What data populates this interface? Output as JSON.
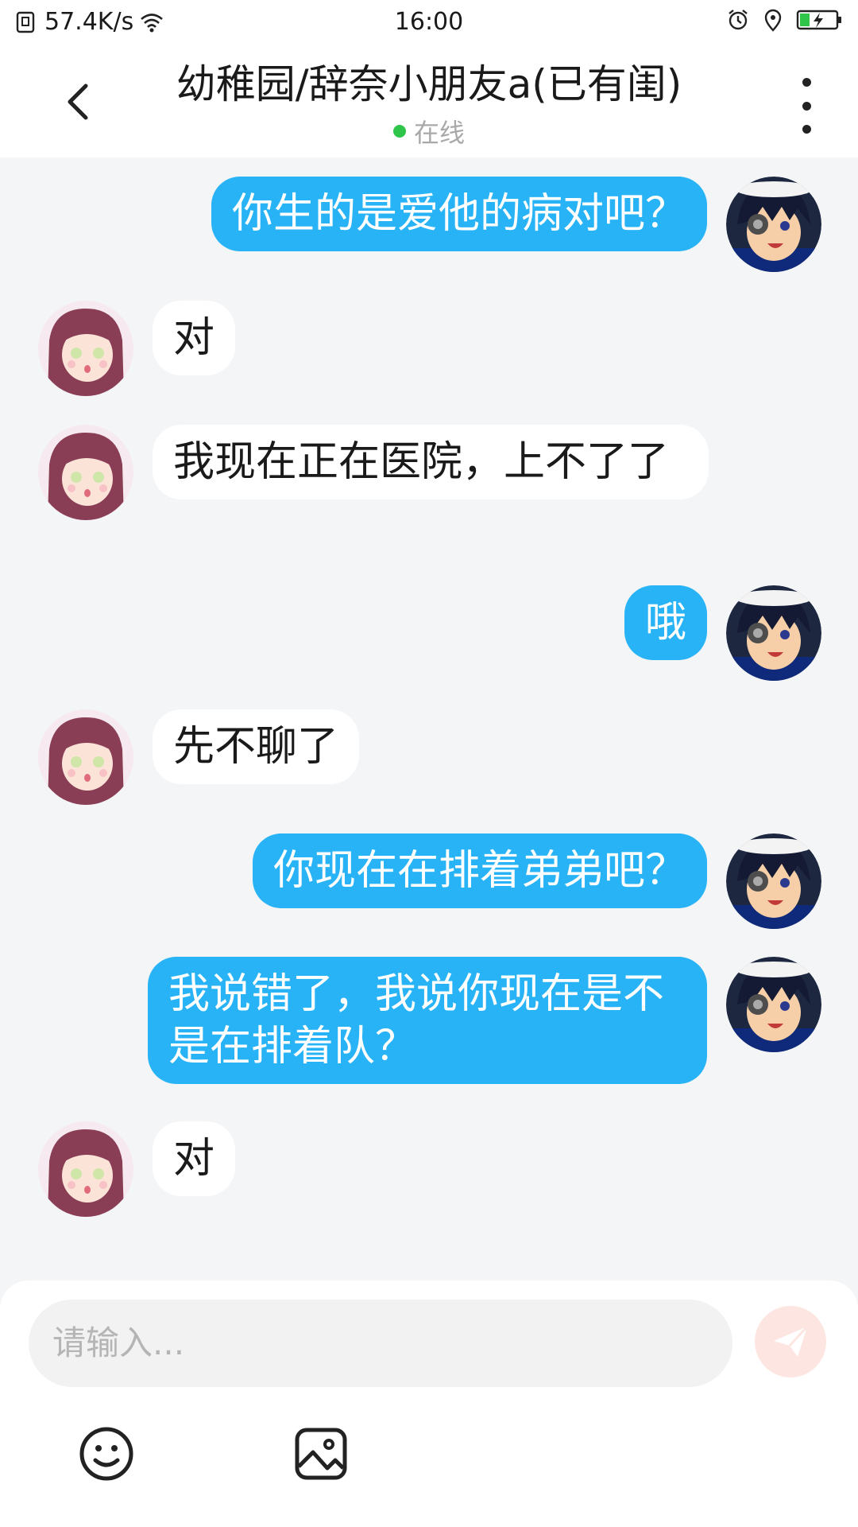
{
  "status_bar": {
    "network_speed": "57.4K/s",
    "time": "16:00",
    "icons": [
      "sim-icon",
      "wifi-icon",
      "alarm-icon",
      "location-icon",
      "battery-charging-icon"
    ]
  },
  "header": {
    "title": "幼稚园/辞奈小朋友a(已有闺)",
    "presence": "在线",
    "presence_color": "#2fc54a"
  },
  "colors": {
    "outgoing_bubble": "#27b3f6",
    "incoming_bubble": "#ffffff",
    "background": "#f3f5f7"
  },
  "messages": [
    {
      "direction": "out",
      "text": "你生的是爱他的病对吧？"
    },
    {
      "direction": "in",
      "text": "对"
    },
    {
      "direction": "in",
      "text": "我现在正在医院，上不了了"
    },
    {
      "direction": "out",
      "text": "哦"
    },
    {
      "direction": "in",
      "text": "先不聊了"
    },
    {
      "direction": "out",
      "text": "你现在在排着弟弟吧？"
    },
    {
      "direction": "out",
      "text": "我说错了，我说你现在是不是在排着队？"
    },
    {
      "direction": "in",
      "text": "对"
    }
  ],
  "composer": {
    "placeholder": "请输入...",
    "tools": [
      "emoji-icon",
      "image-icon"
    ],
    "send_icon": "send-icon"
  }
}
